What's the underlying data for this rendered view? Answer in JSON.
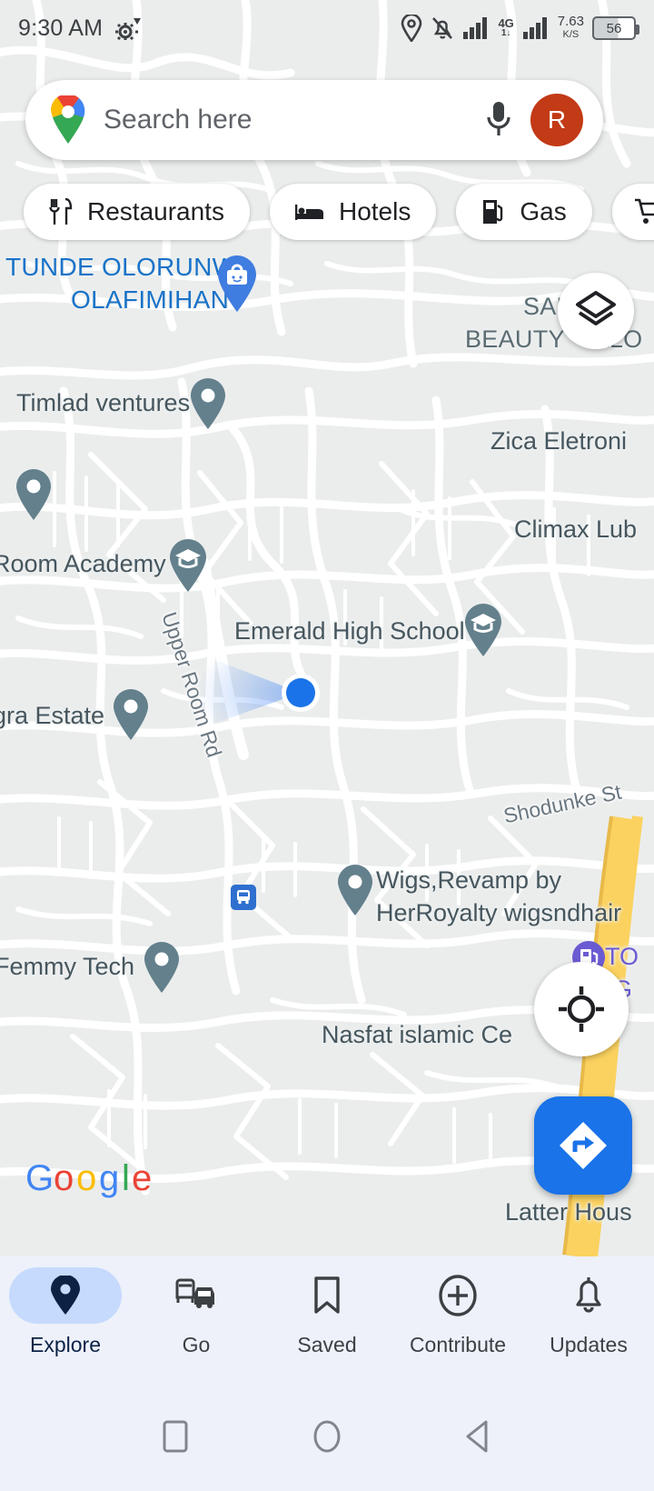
{
  "status_bar": {
    "time": "9:30 AM",
    "network_speed": "7.63",
    "speed_unit": "K/S",
    "network_type": "4G",
    "network_sub": "1↓",
    "battery_level": "56",
    "icons": [
      "gear-wifi-icon",
      "location-icon",
      "bell-muted-icon",
      "signal-bars-icon",
      "signal-bars-2-icon",
      "battery-icon"
    ]
  },
  "search": {
    "placeholder": "Search here",
    "avatar_initial": "R",
    "logo": "google-maps-pin-logo",
    "mic": "microphone-icon"
  },
  "chips": [
    {
      "label": "Restaurants",
      "icon": "restaurant-icon"
    },
    {
      "label": "Hotels",
      "icon": "hotel-bed-icon"
    },
    {
      "label": "Gas",
      "icon": "gas-pump-icon"
    },
    {
      "label": "",
      "icon": "shopping-cart-icon"
    }
  ],
  "map": {
    "attribution": "Google",
    "labels": [
      {
        "id": "tunde-olorunwa",
        "line1": "TUNDE OLORUNWA",
        "line2": "OLAFIMIHAN",
        "color": "blue"
      },
      {
        "id": "beauty-salon",
        "line1": "BEAUTY",
        "line2": "SALON"
      },
      {
        "id": "timlad-ventures",
        "text": "Timlad ventures"
      },
      {
        "id": "zica-eletronics",
        "text": "Zica Eletroni"
      },
      {
        "id": "climax-lub",
        "text": "Climax Lub"
      },
      {
        "id": "room-academy",
        "text": "Room Academy"
      },
      {
        "id": "emerald-high-school",
        "text": "Emerald High School"
      },
      {
        "id": "agra-estate",
        "text": "gra Estate"
      },
      {
        "id": "upper-room-rd",
        "text": "Upper Room Rd"
      },
      {
        "id": "shodunke-st",
        "text": "Shodunke St"
      },
      {
        "id": "wigs-revamp-1",
        "text": "Wigs,Revamp by"
      },
      {
        "id": "wigs-revamp-2",
        "text": "HerRoyalty wigsndhair"
      },
      {
        "id": "femmy-tech",
        "text": "Femmy Tech"
      },
      {
        "id": "nasfat-islamic-centre",
        "text": "Nasfat islamic Ce"
      },
      {
        "id": "total-gas-1",
        "text": "TO"
      },
      {
        "id": "total-gas-2",
        "text": "(G"
      },
      {
        "id": "latter-house",
        "text": "Latter Hous"
      }
    ],
    "pins": [
      {
        "id": "tunde-olorunwa-pin",
        "type": "shopping-bag-pin",
        "color": "#3f7de0"
      },
      {
        "id": "timlad-ventures-pin",
        "type": "dot-pin",
        "color": "#63808c"
      },
      {
        "id": "left-edge-pin",
        "type": "dot-pin",
        "color": "#63808c"
      },
      {
        "id": "room-academy-pin",
        "type": "school-pin",
        "color": "#63808c"
      },
      {
        "id": "emerald-high-school-pin",
        "type": "school-pin",
        "color": "#63808c"
      },
      {
        "id": "agra-estate-pin",
        "type": "dot-pin",
        "color": "#63808c"
      },
      {
        "id": "wigs-revamp-pin",
        "type": "dot-pin",
        "color": "#63808c"
      },
      {
        "id": "femmy-tech-pin",
        "type": "dot-pin",
        "color": "#63808c"
      },
      {
        "id": "bus-stop-pin",
        "type": "bus-stop-icon",
        "color": "#2f6fd0"
      },
      {
        "id": "total-gas-pin",
        "type": "gas-station-icon",
        "color": "#6b5bd2"
      }
    ],
    "user_location": {
      "label": "current-location-dot",
      "color": "#1a73e8"
    },
    "controls": {
      "layers": "layers-icon",
      "recenter": "recenter-crosshair-icon",
      "directions": "directions-arrow-icon"
    }
  },
  "bottom_nav": {
    "items": [
      {
        "label": "Explore",
        "icon": "map-pin-icon",
        "active": true
      },
      {
        "label": "Go",
        "icon": "commute-icon",
        "active": false
      },
      {
        "label": "Saved",
        "icon": "bookmark-icon",
        "active": false
      },
      {
        "label": "Contribute",
        "icon": "plus-circle-icon",
        "active": false
      },
      {
        "label": "Updates",
        "icon": "bell-icon",
        "active": false
      }
    ]
  },
  "system_nav": {
    "recents": "square-recents-icon",
    "home": "circle-home-icon",
    "back": "triangle-back-icon"
  },
  "colors": {
    "accent_blue": "#1a73e8",
    "avatar_red": "#c23a16",
    "highway_yellow": "#fbd25f",
    "map_bg": "#ebeded",
    "label_gray": "#46565e",
    "nav_bg": "#eef1fa"
  }
}
